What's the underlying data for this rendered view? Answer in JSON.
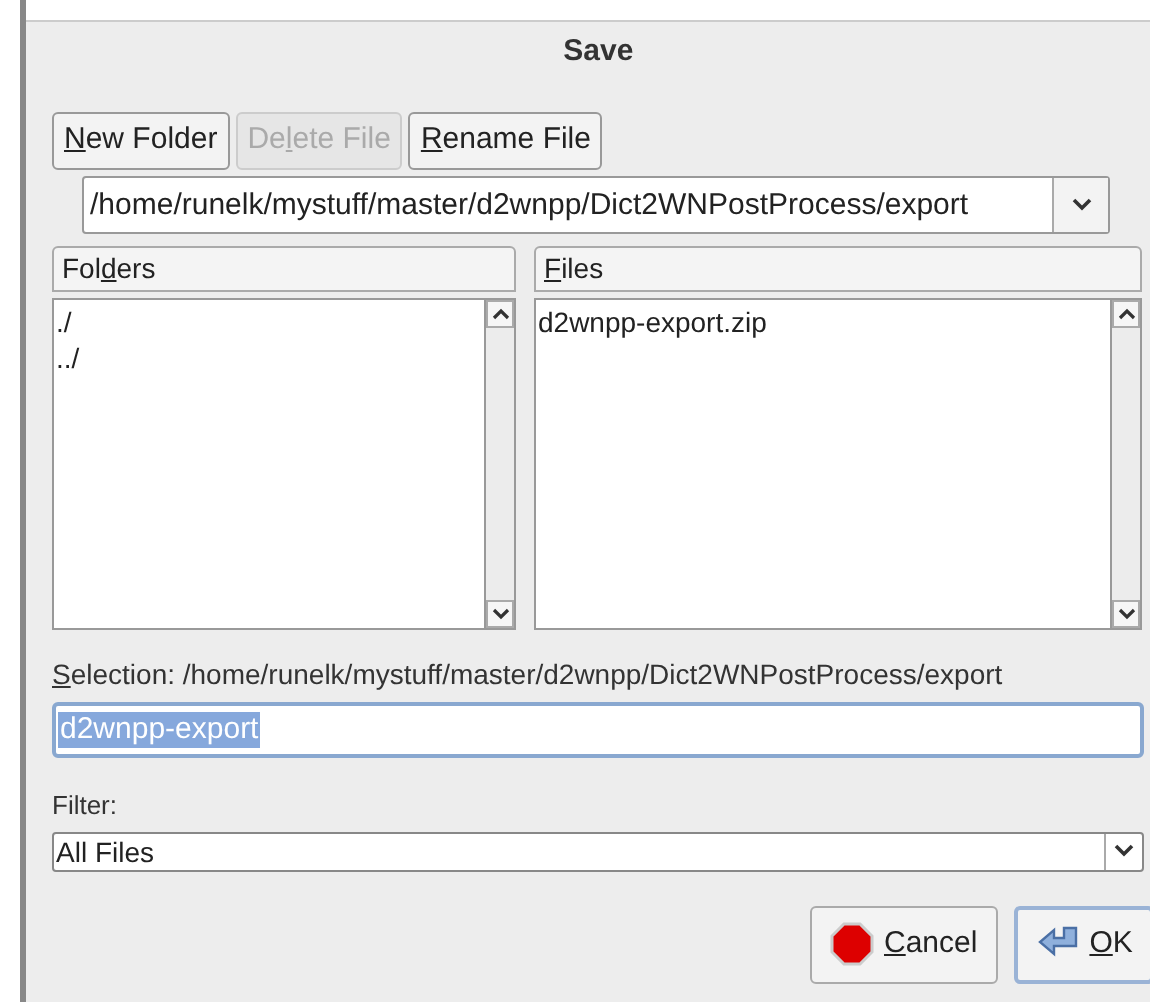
{
  "window": {
    "title": "Save"
  },
  "toolbar": [
    {
      "label": {
        "key": "N",
        "post": "ew Folder"
      },
      "disabled": false
    },
    {
      "label": {
        "pre": "De",
        "key": "l",
        "post": "ete File"
      },
      "disabled": true
    },
    {
      "label": {
        "key": "R",
        "post": "ename File"
      },
      "disabled": false
    }
  ],
  "path_combo": {
    "value": "/home/runelk/mystuff/master/d2wnpp/Dict2WNPostProcess/export"
  },
  "folders": {
    "header": {
      "pre": "Fol",
      "key": "d",
      "post": "ers"
    },
    "items": [
      "./",
      "../"
    ]
  },
  "files": {
    "header": {
      "key": "F",
      "post": "iles"
    },
    "items": [
      "d2wnpp-export.zip"
    ]
  },
  "selection": {
    "label": {
      "key": "S",
      "post": "election: /home/runelk/mystuff/master/d2wnpp/Dict2WNPostProcess/export"
    },
    "value": "d2wnpp-export",
    "text_selected": true
  },
  "filter": {
    "label": "Filter:",
    "value": "All Files"
  },
  "buttons": [
    {
      "kind": "cancel",
      "label": {
        "key": "C",
        "post": "ancel"
      },
      "default": false
    },
    {
      "kind": "ok",
      "label": {
        "key": "O",
        "post": "K"
      },
      "default": true
    }
  ]
}
